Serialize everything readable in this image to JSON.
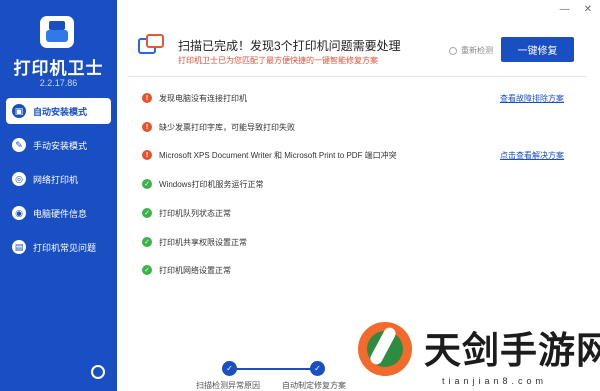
{
  "sidebar": {
    "app_name": "打印机卫士",
    "version": "2.2.17.86",
    "items": [
      {
        "label": "自动安装模式",
        "active": true
      },
      {
        "label": "手动安装模式",
        "active": false
      },
      {
        "label": "网络打印机",
        "active": false
      },
      {
        "label": "电脑硬件信息",
        "active": false
      },
      {
        "label": "打印机常见问题",
        "active": false
      }
    ]
  },
  "header": {
    "title": "扫描已完成！发现3个打印机问题需要处理",
    "subtitle": "打印机卫士已为您匹配了最方便快捷的一键智能修复方案",
    "recheck_label": "重新检测",
    "fix_button": "一键修复"
  },
  "issues": [
    {
      "text": "发现电脑没有连接打印机",
      "status": "error",
      "link": "查看故障排除方案"
    },
    {
      "text": "缺少发票打印字库，可能导致打印失败",
      "status": "error",
      "link": ""
    },
    {
      "text": "Microsoft XPS Document Writer 和 Microsoft Print to PDF 端口冲突",
      "status": "error",
      "link": "点击查看解决方案"
    },
    {
      "text": "Windows打印机服务运行正常",
      "status": "ok",
      "link": ""
    },
    {
      "text": "打印机队列状态正常",
      "status": "ok",
      "link": ""
    },
    {
      "text": "打印机共享权限设置正常",
      "status": "ok",
      "link": ""
    },
    {
      "text": "打印机网络设置正常",
      "status": "ok",
      "link": ""
    }
  ],
  "steps": [
    {
      "label": "扫描检测异常原因"
    },
    {
      "label": "自动制定修复方案"
    }
  ],
  "watermark": {
    "text": "天剑手游网",
    "url": "tianjian8.com"
  },
  "colors": {
    "brand": "#1a4fc4",
    "error": "#e4532c",
    "ok": "#3cb24a"
  }
}
